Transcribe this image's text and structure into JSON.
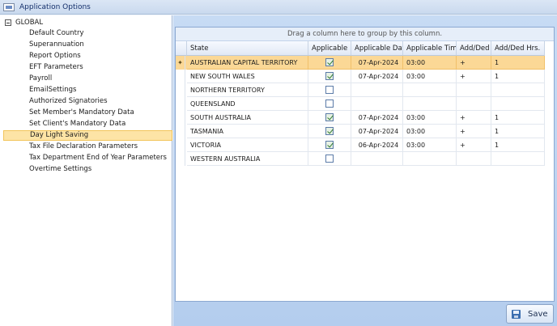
{
  "window": {
    "title": "Application Options"
  },
  "tree": {
    "root": "GLOBAL",
    "items": [
      "Default Country",
      "Superannuation",
      "Report Options",
      "EFT Parameters",
      "Payroll",
      "EmailSettings",
      "Authorized Signatories",
      "Set Member's Mandatory Data",
      "Set Client's Mandatory Data",
      "Day Light Saving",
      "Tax File Declaration Parameters",
      "Tax Department End of Year Parameters",
      "Overtime Settings"
    ],
    "selected_index": 9
  },
  "grid": {
    "group_panel_text": "Drag a column here to group by this column.",
    "columns": [
      "State",
      "Applicable",
      "Applicable Date",
      "Applicable Time",
      "Add/Ded",
      "Add/Ded Hrs."
    ],
    "rows": [
      {
        "state": "AUSTRALIAN CAPITAL TERRITORY",
        "applicable": true,
        "date": "07-Apr-2024",
        "time": "03:00",
        "add_ded": "+",
        "hrs": "1"
      },
      {
        "state": "NEW SOUTH WALES",
        "applicable": true,
        "date": "07-Apr-2024",
        "time": "03:00",
        "add_ded": "+",
        "hrs": "1"
      },
      {
        "state": "NORTHERN TERRITORY",
        "applicable": false,
        "date": "",
        "time": "",
        "add_ded": "",
        "hrs": ""
      },
      {
        "state": "QUEENSLAND",
        "applicable": false,
        "date": "",
        "time": "",
        "add_ded": "",
        "hrs": ""
      },
      {
        "state": "SOUTH AUSTRALIA",
        "applicable": true,
        "date": "07-Apr-2024",
        "time": "03:00",
        "add_ded": "+",
        "hrs": "1"
      },
      {
        "state": "TASMANIA",
        "applicable": true,
        "date": "07-Apr-2024",
        "time": "03:00",
        "add_ded": "+",
        "hrs": "1"
      },
      {
        "state": "VICTORIA",
        "applicable": true,
        "date": "06-Apr-2024",
        "time": "03:00",
        "add_ded": "+",
        "hrs": "1"
      },
      {
        "state": "WESTERN AUSTRALIA",
        "applicable": false,
        "date": "",
        "time": "",
        "add_ded": "",
        "hrs": ""
      }
    ],
    "selected_row": 0,
    "row_indicator": "✦"
  },
  "buttons": {
    "save_label": "Save"
  },
  "icons": {
    "app": "app-logo-icon",
    "save": "floppy-disk-icon",
    "tree_toggle": "collapse-minus-icon"
  },
  "colors": {
    "selection": "#fbd896",
    "accent": "#3c6fb0"
  }
}
